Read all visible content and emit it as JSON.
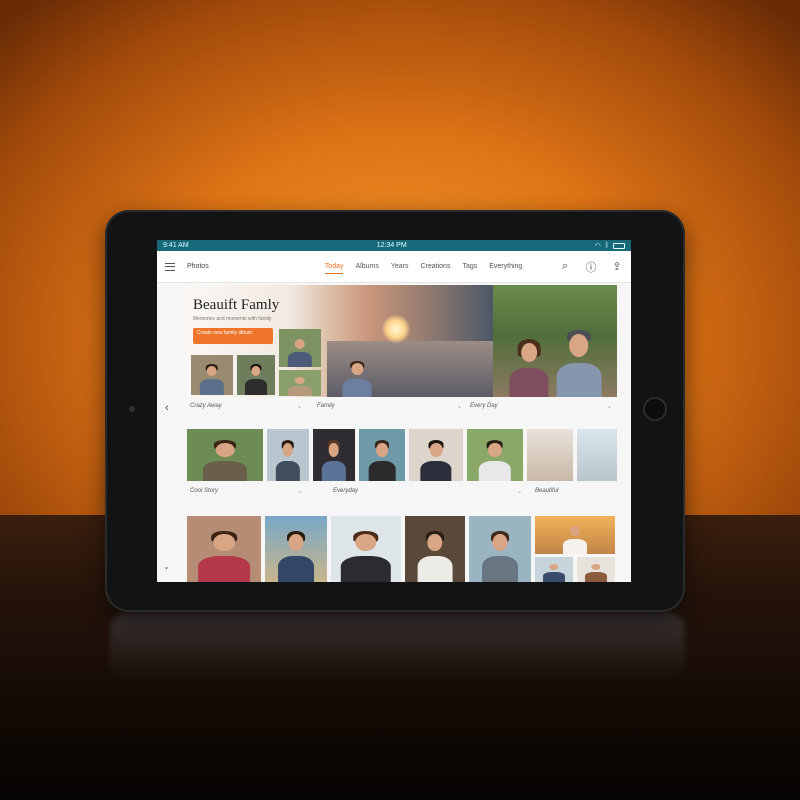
{
  "status": {
    "left": "9:41 AM",
    "center": "12:34 PM",
    "right": ""
  },
  "appbar": {
    "brand": "Photos",
    "tabs": [
      "Today",
      "Albums",
      "Years",
      "Creations",
      "Tags",
      "Everything"
    ],
    "active_tab": 0
  },
  "hero": {
    "title": "Beauift Famly",
    "subtitle": "Memories and moments with family",
    "cta": "Create new family album"
  },
  "sections": [
    {
      "labels": [
        "Crazy Away",
        "Family",
        "Every Day"
      ]
    },
    {
      "labels": [
        "Cool Story",
        "Everyday",
        "Beautiful"
      ]
    }
  ],
  "colors": {
    "accent": "#e8731e",
    "statusbar": "#17697a"
  },
  "icons": {
    "menu": "hamburger-icon",
    "search": "search-icon",
    "info": "info-icon",
    "share": "share-icon",
    "back": "chevron-left-icon"
  }
}
